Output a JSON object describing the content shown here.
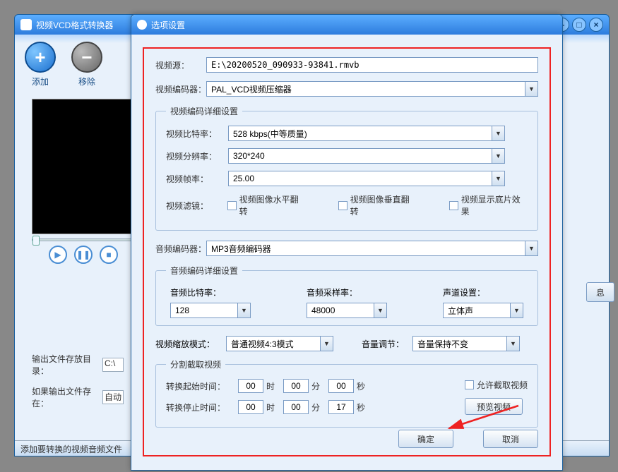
{
  "mainWindow": {
    "title": "视频VCD格式转换器"
  },
  "toolbar": {
    "add": "添加",
    "remove": "移除"
  },
  "bottomForm": {
    "outputDirLabel": "输出文件存放目录：",
    "outputDirValue": "C:\\",
    "ifExistsLabel": "如果输出文件存在：",
    "ifExistsValue": "自动"
  },
  "statusBar": "添加要转换的视频音频文件",
  "hiddenBtn": "息",
  "dialog": {
    "title": "选项设置",
    "videoSourceLabel": "视频源：",
    "videoSourceValue": "E:\\20200520_090933-93841.rmvb",
    "videoEncoderLabel": "视频编码器：",
    "videoEncoderValue": "PAL_VCD视频压缩器",
    "videoDetail": {
      "legend": "视频编码详细设置",
      "bitrateLabel": "视频比特率：",
      "bitrateValue": "528 kbps(中等质量)",
      "resolutionLabel": "视频分辨率：",
      "resolutionValue": "320*240",
      "fpsLabel": "视频帧率：",
      "fpsValue": "25.00",
      "filterLabel": "视频滤镜：",
      "flipH": "视频图像水平翻转",
      "flipV": "视频图像垂直翻转",
      "negative": "视频显示底片效果"
    },
    "audioEncoderLabel": "音频编码器：",
    "audioEncoderValue": "MP3音频编码器",
    "audioDetail": {
      "legend": "音频编码详细设置",
      "bitrateLabel": "音频比特率：",
      "bitrateValue": "128",
      "sampleLabel": "音频采样率：",
      "sampleValue": "48000",
      "channelLabel": "声道设置：",
      "channelValue": "立体声"
    },
    "scaleLabel": "视频缩放模式：",
    "scaleValue": "普通视频4:3模式",
    "volumeLabel": "音量调节：",
    "volumeValue": "音量保持不变",
    "cut": {
      "legend": "分割截取视频",
      "startLabel": "转换起始时间：",
      "stopLabel": "转换停止时间：",
      "h": "时",
      "m": "分",
      "s": "秒",
      "startH": "00",
      "startM": "00",
      "startS": "00",
      "stopH": "00",
      "stopM": "00",
      "stopS": "17",
      "allowCut": "允许截取视频",
      "previewBtn": "预览视频"
    },
    "ok": "确定",
    "cancel": "取消"
  }
}
